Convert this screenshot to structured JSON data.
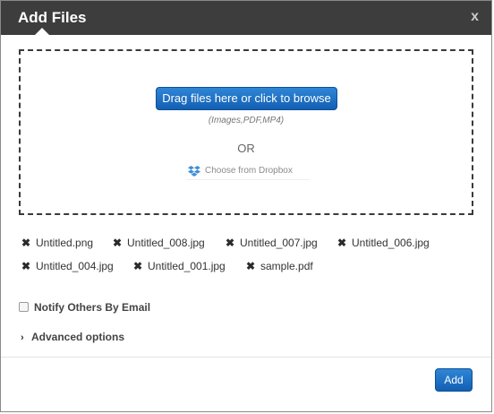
{
  "dialog": {
    "title": "Add Files",
    "close_label": "x"
  },
  "dropzone": {
    "browse_label": "Drag files here or click to browse",
    "types_hint": "(Images,PDF,MP4)",
    "or_label": "OR",
    "dropbox_label": "Choose from Dropbox",
    "dropbox_icon": "dropbox-icon"
  },
  "files": [
    {
      "name": "Untitled.png"
    },
    {
      "name": "Untitled_008.jpg"
    },
    {
      "name": "Untitled_007.jpg"
    },
    {
      "name": "Untitled_006.jpg"
    },
    {
      "name": "Untitled_004.jpg"
    },
    {
      "name": "Untitled_001.jpg"
    },
    {
      "name": "sample.pdf"
    }
  ],
  "remove_glyph": "✖",
  "options": {
    "notify_label": "Notify Others By Email",
    "notify_checked": false,
    "advanced_label": "Advanced options",
    "advanced_glyph": "›"
  },
  "footer": {
    "add_label": "Add"
  },
  "colors": {
    "titlebar": "#3d3d3d",
    "button": "#1a6fc4"
  }
}
